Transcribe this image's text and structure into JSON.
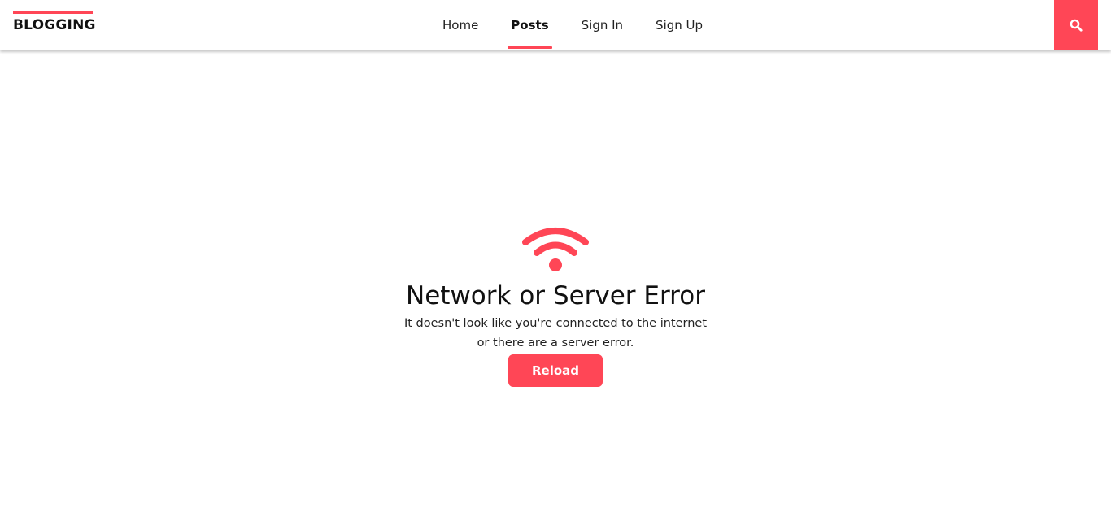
{
  "brand": {
    "name": "BLOGGING",
    "accent_color": "#ff4656"
  },
  "nav": {
    "items": [
      {
        "label": "Home",
        "active": false
      },
      {
        "label": "Posts",
        "active": true
      },
      {
        "label": "Sign In",
        "active": false
      },
      {
        "label": "Sign Up",
        "active": false
      }
    ]
  },
  "search": {
    "icon": "search-icon",
    "color": "#ff4656"
  },
  "error": {
    "icon": "wifi-icon",
    "title": "Network or Server Error",
    "line1": "It doesn't look like you're connected to the internet",
    "line2": "or there are a server error.",
    "button_label": "Reload"
  }
}
